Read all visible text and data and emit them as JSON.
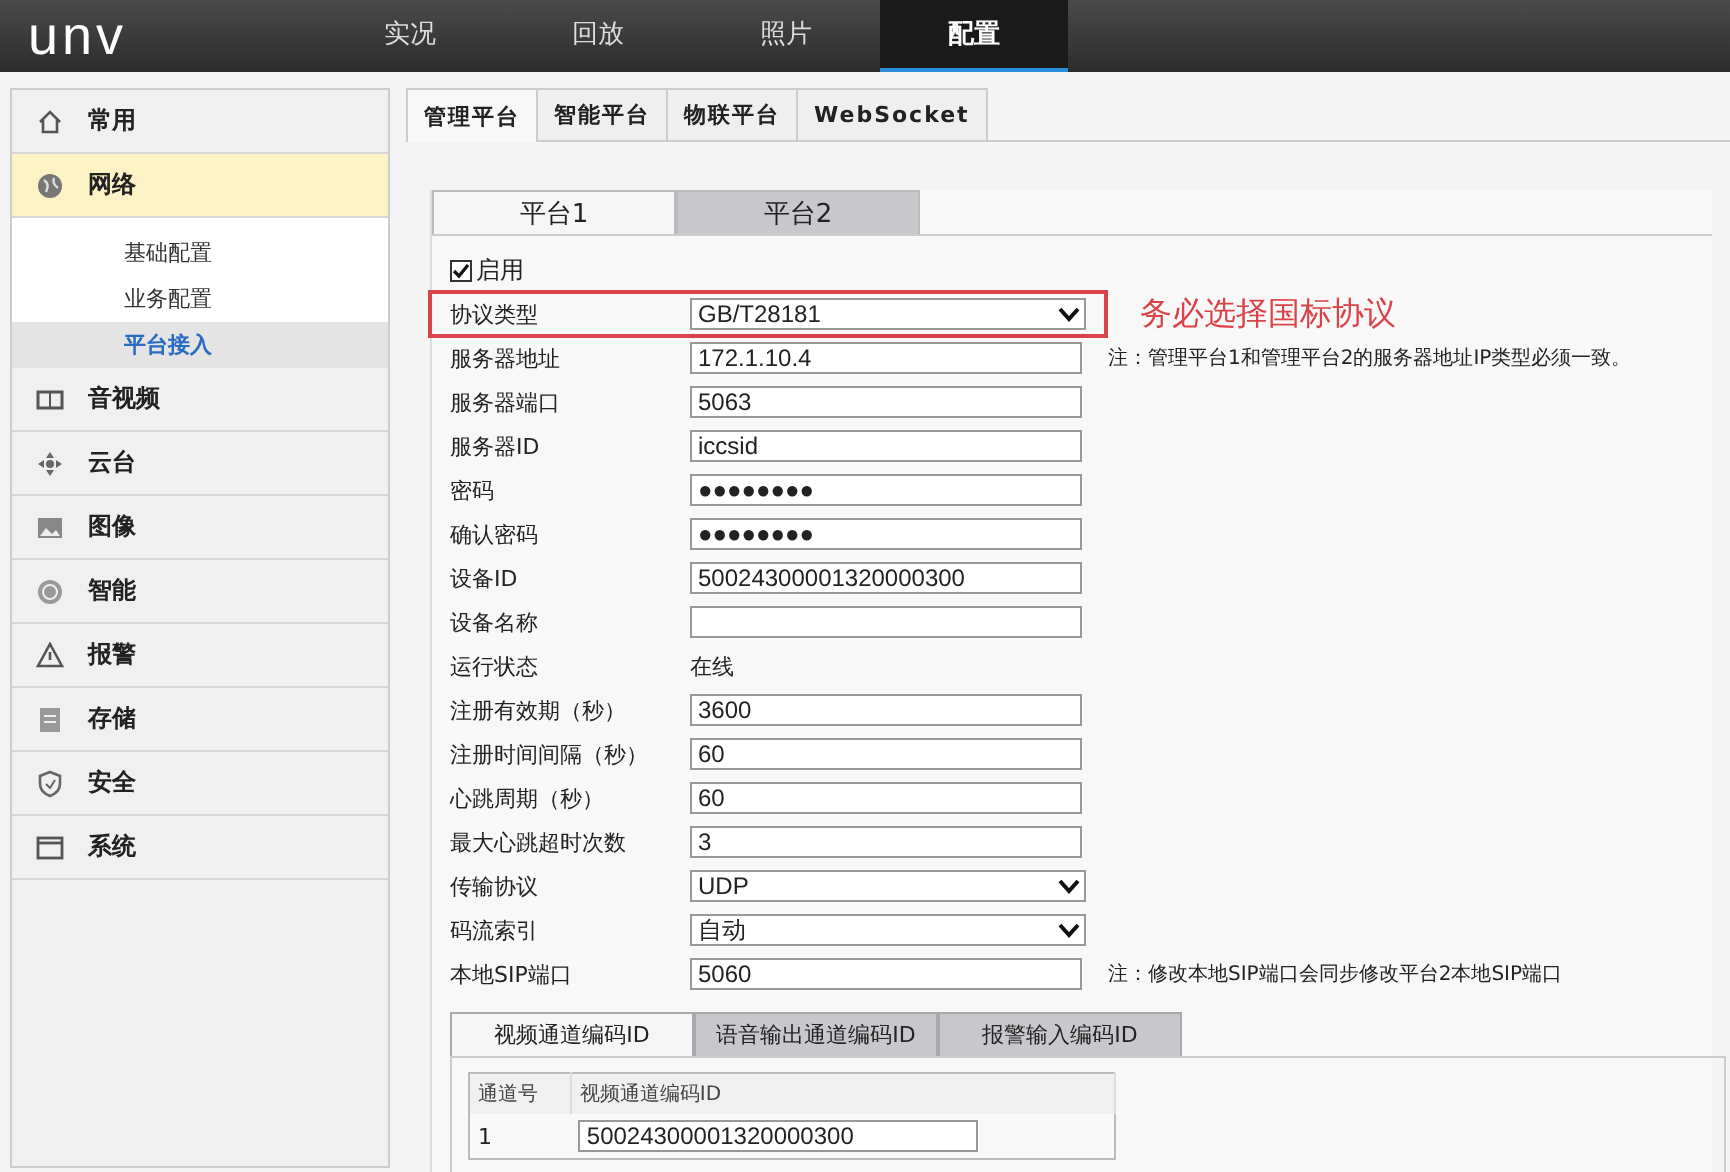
{
  "header": {
    "logo": "unv",
    "nav": [
      {
        "label": "实况",
        "selected": false
      },
      {
        "label": "回放",
        "selected": false
      },
      {
        "label": "照片",
        "selected": false
      },
      {
        "label": "配置",
        "selected": true
      }
    ]
  },
  "sidebar": {
    "items": [
      {
        "label": "常用",
        "selected": false
      },
      {
        "label": "网络",
        "selected": true,
        "expanded": true,
        "children": [
          {
            "label": "基础配置",
            "selected": false
          },
          {
            "label": "业务配置",
            "selected": false
          },
          {
            "label": "平台接入",
            "selected": true
          }
        ]
      },
      {
        "label": "音视频",
        "selected": false
      },
      {
        "label": "云台",
        "selected": false
      },
      {
        "label": "图像",
        "selected": false
      },
      {
        "label": "智能",
        "selected": false
      },
      {
        "label": "报警",
        "selected": false
      },
      {
        "label": "存储",
        "selected": false
      },
      {
        "label": "安全",
        "selected": false
      },
      {
        "label": "系统",
        "selected": false
      }
    ]
  },
  "tabs": [
    {
      "label": "管理平台",
      "selected": true
    },
    {
      "label": "智能平台",
      "selected": false
    },
    {
      "label": "物联平台",
      "selected": false
    },
    {
      "label": "WebSocket",
      "selected": false
    }
  ],
  "platform_tabs": [
    {
      "label": "平台1",
      "selected": true
    },
    {
      "label": "平台2",
      "selected": false
    }
  ],
  "form": {
    "rows": [
      {
        "kind": "checkbox",
        "label": "启用",
        "checked": true
      },
      {
        "kind": "select",
        "label": "协议类型",
        "value": "GB/T28181",
        "highlighted": true,
        "annotation": "务必选择国标协议"
      },
      {
        "kind": "text",
        "label": "服务器地址",
        "value": "172.1.10.4",
        "note": "注：管理平台1和管理平台2的服务器地址IP类型必须一致。"
      },
      {
        "kind": "text",
        "label": "服务器端口",
        "value": "5063"
      },
      {
        "kind": "text",
        "label": "服务器ID",
        "value": "iccsid"
      },
      {
        "kind": "password",
        "label": "密码",
        "value": "●●●●●●●●"
      },
      {
        "kind": "password",
        "label": "确认密码",
        "value": "●●●●●●●●"
      },
      {
        "kind": "text",
        "label": "设备ID",
        "value": "50024300001320000300"
      },
      {
        "kind": "text",
        "label": "设备名称"
      },
      {
        "kind": "static",
        "label": "运行状态",
        "value": "在线"
      },
      {
        "kind": "text",
        "label": "注册有效期（秒）",
        "value": "3600"
      },
      {
        "kind": "text",
        "label": "注册时间间隔（秒）",
        "value": "60"
      },
      {
        "kind": "text",
        "label": "心跳周期（秒）",
        "value": "60"
      },
      {
        "kind": "text",
        "label": "最大心跳超时次数",
        "value": "3"
      },
      {
        "kind": "select",
        "label": "传输协议",
        "value": "UDP"
      },
      {
        "kind": "select",
        "label": "码流索引",
        "value": "自动"
      },
      {
        "kind": "text",
        "label": "本地SIP端口",
        "value": "5060",
        "note": "注：修改本地SIP端口会同步修改平台2本地SIP端口"
      }
    ]
  },
  "code_tabs": [
    {
      "label": "视频通道编码ID",
      "selected": true
    },
    {
      "label": "语音输出通道编码ID",
      "selected": false
    },
    {
      "label": "报警输入编码ID",
      "selected": false
    }
  ],
  "code_table": {
    "columns": [
      "通道号",
      "视频通道编码ID"
    ],
    "rows": [
      [
        "1",
        "50024300001320000300"
      ]
    ]
  }
}
